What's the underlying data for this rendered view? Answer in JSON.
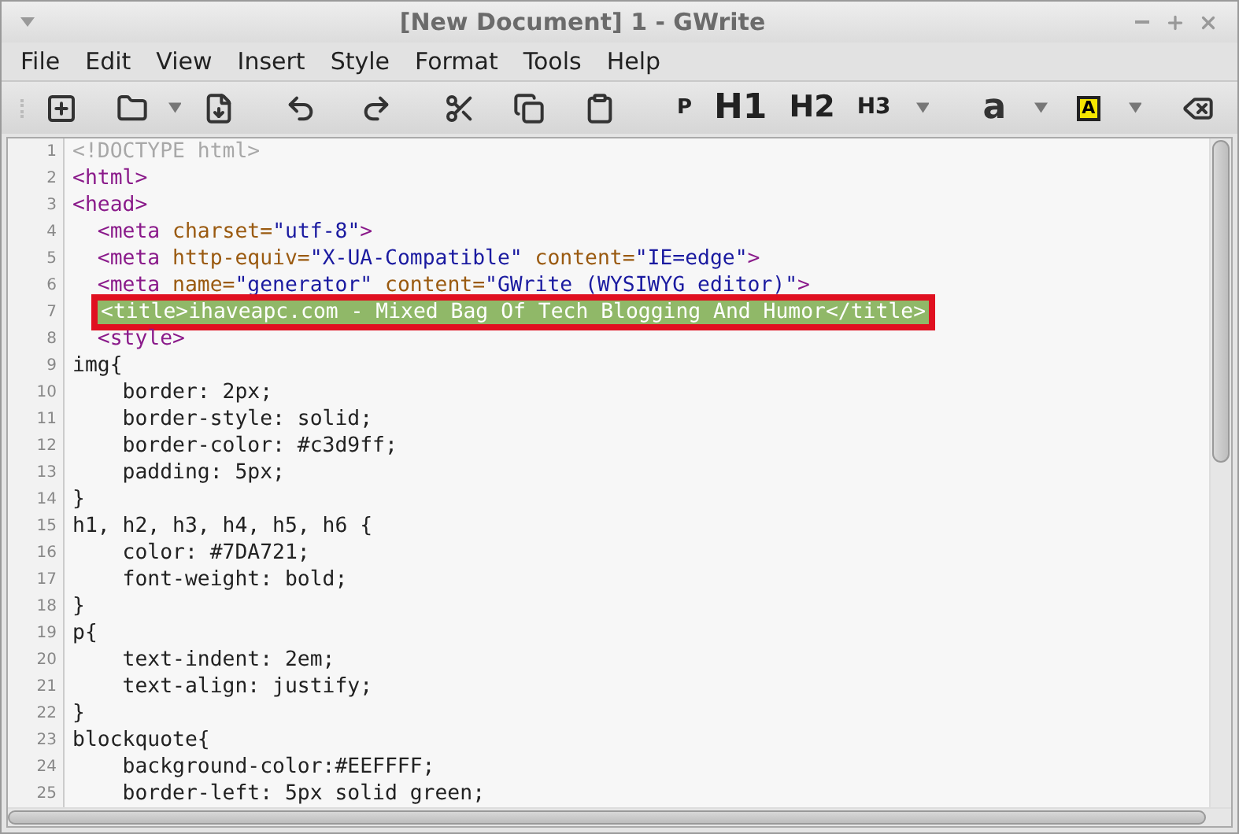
{
  "window": {
    "title": "[New Document] 1 - GWrite"
  },
  "menu": [
    "File",
    "Edit",
    "View",
    "Insert",
    "Style",
    "Format",
    "Tools",
    "Help"
  ],
  "toolbar": {
    "headings": [
      "P",
      "H1",
      "H2",
      "H3"
    ],
    "font_button": "a",
    "highlight_button": "A"
  },
  "code_lines": [
    {
      "number": "1",
      "selected": false,
      "segments": [
        {
          "kind": "doctype",
          "text": "<!DOCTYPE html>"
        }
      ]
    },
    {
      "number": "2",
      "selected": false,
      "segments": [
        {
          "kind": "tag",
          "text": "<html>"
        }
      ]
    },
    {
      "number": "3",
      "selected": false,
      "segments": [
        {
          "kind": "tag",
          "text": "<head>"
        }
      ]
    },
    {
      "number": "4",
      "selected": false,
      "segments": [
        {
          "kind": "tag",
          "text": "  <meta "
        },
        {
          "kind": "attr",
          "text": "charset="
        },
        {
          "kind": "string",
          "text": "\"utf-8\""
        },
        {
          "kind": "tag",
          "text": ">"
        }
      ]
    },
    {
      "number": "5",
      "selected": false,
      "segments": [
        {
          "kind": "tag",
          "text": "  <meta "
        },
        {
          "kind": "attr",
          "text": "http-equiv="
        },
        {
          "kind": "string",
          "text": "\"X-UA-Compatible\""
        },
        {
          "kind": "attr",
          "text": " content="
        },
        {
          "kind": "string",
          "text": "\"IE=edge\""
        },
        {
          "kind": "tag",
          "text": ">"
        }
      ]
    },
    {
      "number": "6",
      "selected": false,
      "segments": [
        {
          "kind": "tag",
          "text": "  <meta "
        },
        {
          "kind": "attr",
          "text": "name="
        },
        {
          "kind": "string",
          "text": "\"generator\""
        },
        {
          "kind": "attr",
          "text": " content="
        },
        {
          "kind": "string",
          "text": "\"GWrite (WYSIWYG editor)\""
        },
        {
          "kind": "tag",
          "text": ">"
        }
      ]
    },
    {
      "number": "7",
      "selected": true,
      "segments": [
        {
          "kind": "tag",
          "text": "<title>ihaveapc.com - Mixed Bag Of Tech Blogging And Humor</title>"
        }
      ]
    },
    {
      "number": "8",
      "selected": false,
      "segments": [
        {
          "kind": "tag",
          "text": "  <style>"
        }
      ]
    },
    {
      "number": "9",
      "selected": false,
      "segments": [
        {
          "kind": "plain",
          "text": "img{"
        }
      ]
    },
    {
      "number": "10",
      "selected": false,
      "segments": [
        {
          "kind": "plain",
          "text": "    border: 2px;"
        }
      ]
    },
    {
      "number": "11",
      "selected": false,
      "segments": [
        {
          "kind": "plain",
          "text": "    border-style: solid;"
        }
      ]
    },
    {
      "number": "12",
      "selected": false,
      "segments": [
        {
          "kind": "plain",
          "text": "    border-color: #c3d9ff;"
        }
      ]
    },
    {
      "number": "13",
      "selected": false,
      "segments": [
        {
          "kind": "plain",
          "text": "    padding: 5px;"
        }
      ]
    },
    {
      "number": "14",
      "selected": false,
      "segments": [
        {
          "kind": "plain",
          "text": "}"
        }
      ]
    },
    {
      "number": "15",
      "selected": false,
      "segments": [
        {
          "kind": "plain",
          "text": "h1, h2, h3, h4, h5, h6 {"
        }
      ]
    },
    {
      "number": "16",
      "selected": false,
      "segments": [
        {
          "kind": "plain",
          "text": "    color: #7DA721;"
        }
      ]
    },
    {
      "number": "17",
      "selected": false,
      "segments": [
        {
          "kind": "plain",
          "text": "    font-weight: bold;"
        }
      ]
    },
    {
      "number": "18",
      "selected": false,
      "segments": [
        {
          "kind": "plain",
          "text": "}"
        }
      ]
    },
    {
      "number": "19",
      "selected": false,
      "segments": [
        {
          "kind": "plain",
          "text": "p{"
        }
      ]
    },
    {
      "number": "20",
      "selected": false,
      "segments": [
        {
          "kind": "plain",
          "text": "    text-indent: 2em;"
        }
      ]
    },
    {
      "number": "21",
      "selected": false,
      "segments": [
        {
          "kind": "plain",
          "text": "    text-align: justify;"
        }
      ]
    },
    {
      "number": "22",
      "selected": false,
      "segments": [
        {
          "kind": "plain",
          "text": "}"
        }
      ]
    },
    {
      "number": "23",
      "selected": false,
      "segments": [
        {
          "kind": "plain",
          "text": "blockquote{"
        }
      ]
    },
    {
      "number": "24",
      "selected": false,
      "segments": [
        {
          "kind": "plain",
          "text": "    background-color:#EEFFFF;"
        }
      ]
    },
    {
      "number": "25",
      "selected": false,
      "segments": [
        {
          "kind": "plain",
          "text": "    border-left: 5px solid green;"
        }
      ]
    }
  ]
}
